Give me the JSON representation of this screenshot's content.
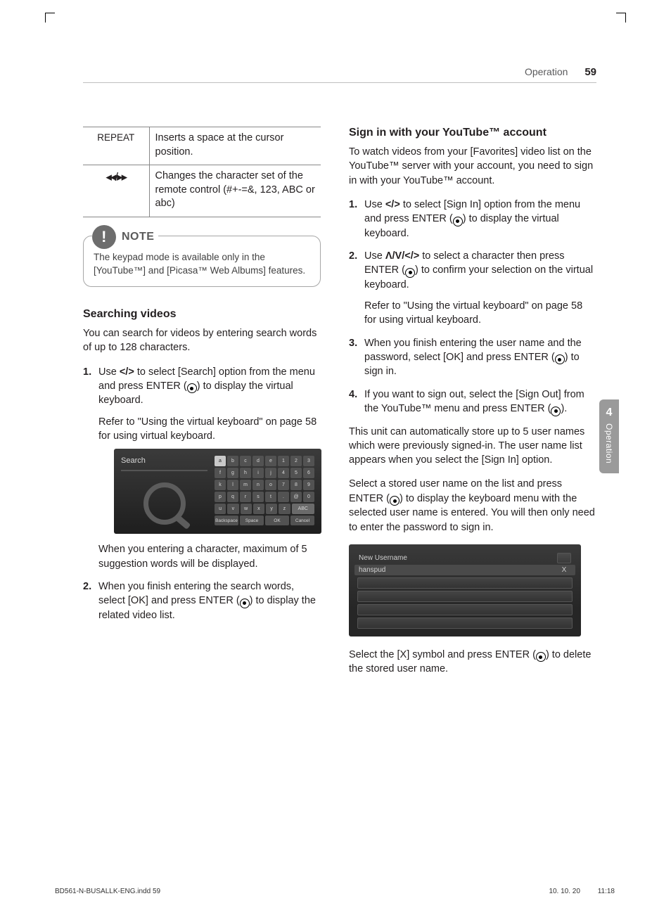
{
  "header": {
    "section": "Operation",
    "page_number": "59"
  },
  "thumb": {
    "chapter": "4",
    "label": "Operation"
  },
  "table": {
    "rows": [
      {
        "key": "REPEAT",
        "desc": "Inserts a space at the cursor position."
      },
      {
        "key_glyph": "◂◂/▸▸",
        "desc": "Changes the character set of the remote control (#+-=&, 123, ABC or abc)"
      }
    ]
  },
  "note": {
    "badge": "NOTE",
    "text": "The keypad mode is available only in the [YouTube™] and [Picasa™ Web Albums] features."
  },
  "left": {
    "h": "Searching videos",
    "intro": "You can search for videos by entering search words of up to 128 characters.",
    "step1a": "Use ",
    "step1_arrows": "</>",
    "step1b": " to select [Search] option from the menu and press ENTER (",
    "step1c": ") to display the virtual keyboard.",
    "step1_sub": "Refer to \"Using the virtual keyboard\" on page 58 for using virtual keyboard.",
    "kbd_caption": "When you entering a character, maximum of 5 suggestion words will be displayed.",
    "step2a": "When you finish entering the search words, select [OK] and press ENTER (",
    "step2b": ") to display the related video list."
  },
  "shot": {
    "title": "Search",
    "keys": [
      [
        "a",
        "b",
        "c",
        "d",
        "e",
        "1",
        "2",
        "3"
      ],
      [
        "f",
        "g",
        "h",
        "i",
        "j",
        "4",
        "5",
        "6"
      ],
      [
        "k",
        "l",
        "m",
        "n",
        "o",
        "7",
        "8",
        "9"
      ],
      [
        "p",
        "q",
        "r",
        "s",
        "t",
        ".",
        "@",
        "0"
      ],
      [
        "u",
        "v",
        "w",
        "x",
        "y",
        "z",
        "ABC"
      ]
    ],
    "bottom": [
      "Backspace",
      "Space",
      "OK",
      "Cancel"
    ]
  },
  "right": {
    "h": "Sign in with your YouTube™ account",
    "intro": "To watch videos from your [Favorites] video list on the YouTube™ server with your account, you need to sign in with your YouTube™ account.",
    "s1a": "Use ",
    "s1_arrows": "</>",
    "s1b": " to select [Sign In] option from the menu and press ENTER (",
    "s1c": ") to display the virtual keyboard.",
    "s2a": "Use ",
    "s2_arrows": "Λ/V/</>",
    "s2b": " to select a character then press ENTER (",
    "s2c": ") to confirm your selection on the virtual keyboard.",
    "s2_sub": "Refer to \"Using the virtual keyboard\" on page 58 for using virtual keyboard.",
    "s3a": "When you finish entering the user name and the password, select [OK] and press ENTER (",
    "s3b": ") to sign in.",
    "s4a": "If you want to sign out, select the [Sign Out] from the YouTube™ menu and press ENTER (",
    "s4b": ").",
    "p_store": "This unit can automatically store up to 5 user names which were previously signed-in. The user name list appears when you select the [Sign In] option.",
    "p_select": "Select a stored user name on the list and press ENTER (",
    "p_select2": ") to display the keyboard menu with the selected user name is entered. You will then only need to enter the password to sign in.",
    "ulist": {
      "new": "New Username",
      "name": "hanspud",
      "x": "X"
    },
    "p_delete_a": "Select the [X] symbol and press ENTER (",
    "p_delete_b": ") to delete the stored user name."
  },
  "footer": {
    "file": "BD561-N-BUSALLK-ENG.indd   59",
    "date": "10. 10. 20",
    "time": "11:18"
  }
}
